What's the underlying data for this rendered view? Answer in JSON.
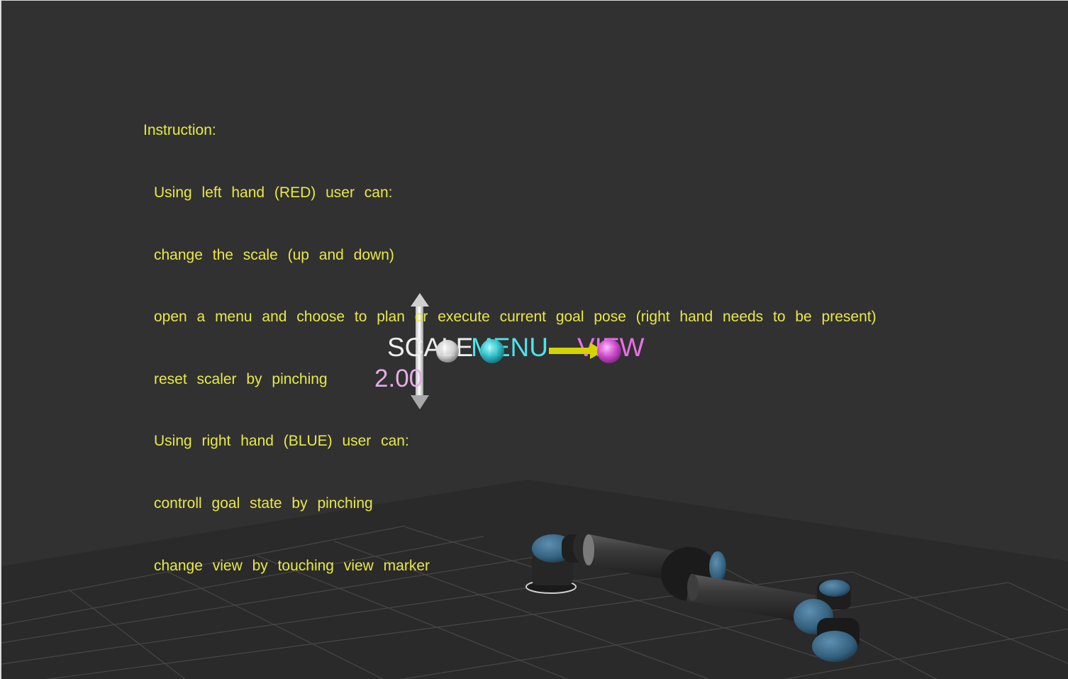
{
  "instructions": {
    "title": "Instruction:",
    "lines": [
      "Using left hand (RED) user can:",
      "change the scale (up and down)",
      "open a menu and choose to plan or execute current goal pose (right hand needs to be present)",
      "reset scaler by pinching",
      "Using right hand (BLUE) user can:",
      "controll goal state by pinching",
      "change view by touching view marker"
    ]
  },
  "markers": {
    "scale_label": "SCALE",
    "scale_value": "2.00",
    "menu_label": "MENU",
    "view_label": "VIEW"
  },
  "colors": {
    "background": "#313131",
    "floor": "#2a2a2a",
    "grid": "#4a4a4a",
    "instruction_text": "#e8e84a",
    "scale": "#eeeeee",
    "scale_value": "#e4aee4",
    "menu": "#4fe3ea",
    "view": "#ea6fea",
    "arrow": "#d8d800",
    "robot_body": "#2e2e2e",
    "robot_cap": "#3c6a8a"
  }
}
